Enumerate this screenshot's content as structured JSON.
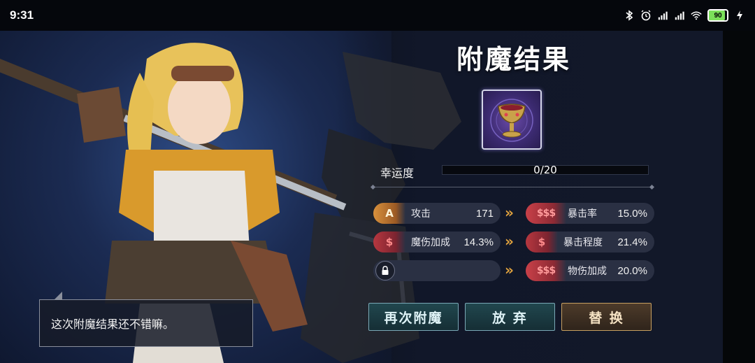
{
  "status_bar": {
    "time": "9:31",
    "battery_level": "90",
    "icons": [
      "bluetooth-icon",
      "alarm-icon",
      "signal-hd-icon",
      "signal-hd-icon",
      "wifi-icon",
      "battery-icon",
      "charging-icon"
    ]
  },
  "dialog": {
    "text": "这次附魔结果还不错嘛。"
  },
  "panel": {
    "title": "附魔结果",
    "luck": {
      "label": "幸运度",
      "value": "0/20",
      "fraction": 0
    },
    "stats_before": [
      {
        "icon_text": "A",
        "name": "攻击",
        "value": "171",
        "badge": "orange"
      },
      {
        "icon_text": "$",
        "name": "魔伤加成",
        "value": "14.3%",
        "badge": "red"
      },
      {
        "icon_text": "",
        "name": "",
        "value": "",
        "badge": "lock"
      }
    ],
    "stats_after": [
      {
        "icon_text": "$$$",
        "name": "暴击率",
        "value": "15.0%",
        "badge": "red"
      },
      {
        "icon_text": "$",
        "name": "暴击程度",
        "value": "21.4%",
        "badge": "red"
      },
      {
        "icon_text": "$$$",
        "name": "物伤加成",
        "value": "20.0%",
        "badge": "red"
      }
    ],
    "arrow": "»",
    "buttons": {
      "reenchant": "再次附魔",
      "abandon": "放 弃",
      "replace": "替 换"
    }
  },
  "colors": {
    "accent_gold": "#e0a23e",
    "button_teal": "#21474e",
    "button_gold": "#4d3b2a"
  }
}
